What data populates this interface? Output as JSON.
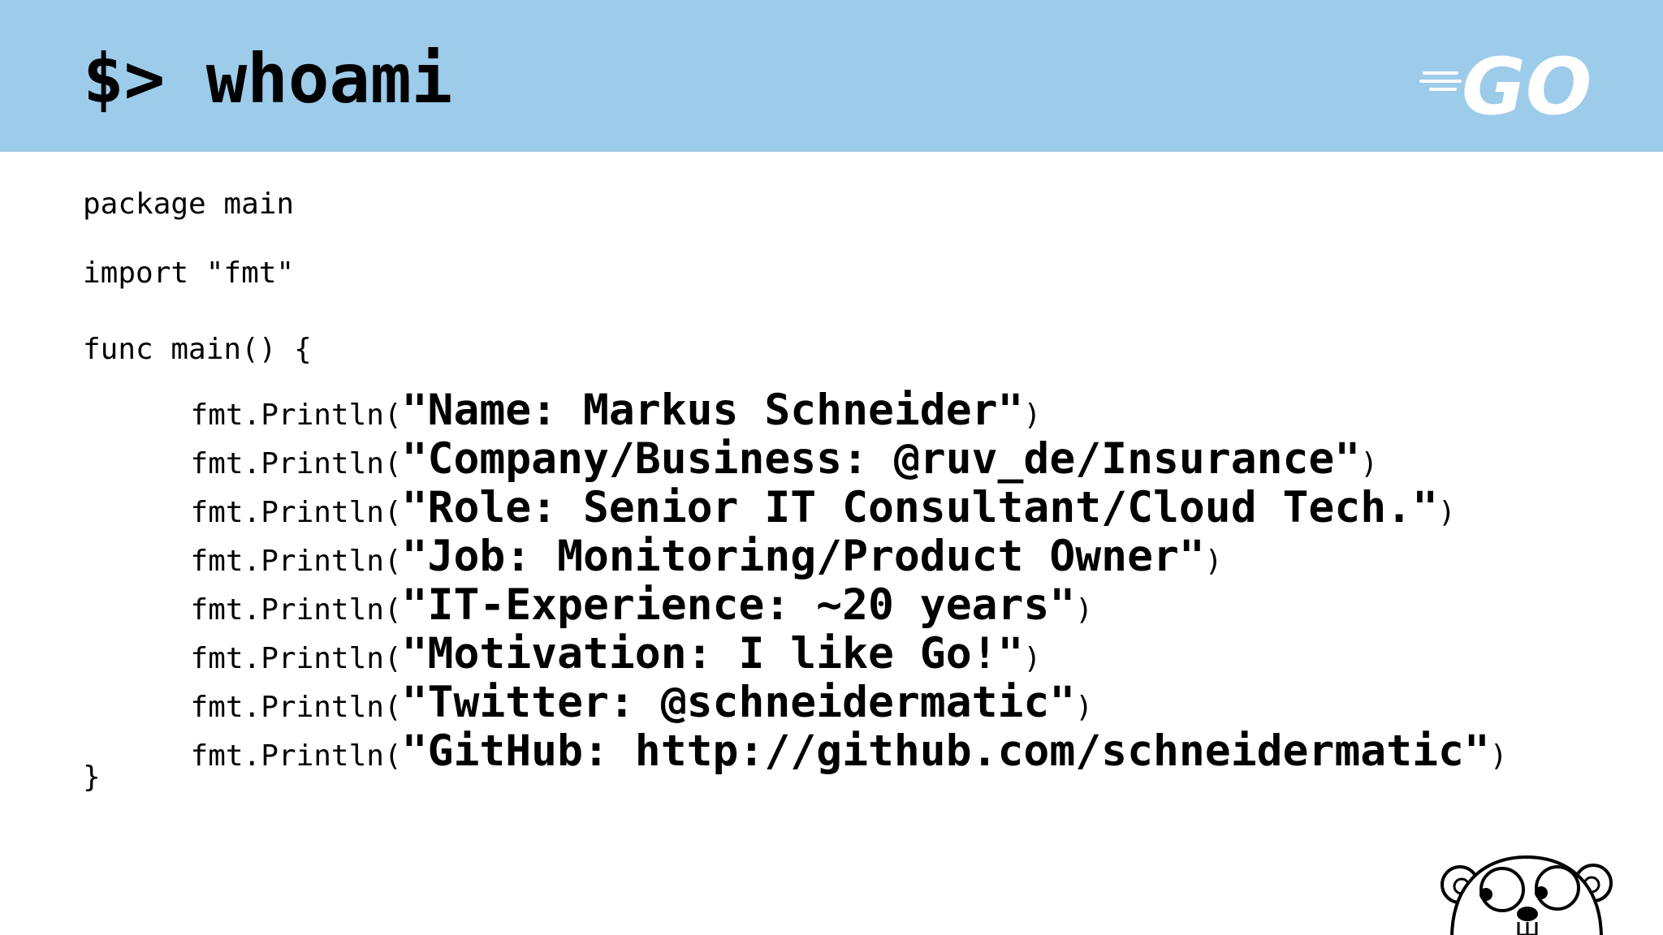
{
  "slide": {
    "title": "$> whoami",
    "code": {
      "package_line": "package main",
      "import_line": "import \"fmt\"",
      "func_open": "func main() {",
      "func_close": "}",
      "call_prefix": "fmt.Println(",
      "call_suffix": ")",
      "prints": [
        "\"Name: Markus Schneider\"",
        "\"Company/Business: @ruv_de/Insurance\"",
        "\"Role: Senior IT Consultant/Cloud Tech.\"",
        "\"Job: Monitoring/Product Owner\"",
        "\"IT-Experience: ~20 years\"",
        "\"Motivation: I like Go!\"",
        "\"Twitter: @schneidermatic\"",
        "\"GitHub: http://github.com/schneidermatic\""
      ]
    }
  },
  "logo": {
    "text": "GO",
    "icon": "go-logo-icon"
  },
  "mascot": {
    "icon": "gopher-mascot-icon"
  },
  "colors": {
    "header_background": "#9dcbea",
    "text": "#000000",
    "logo": "#ffffff"
  }
}
